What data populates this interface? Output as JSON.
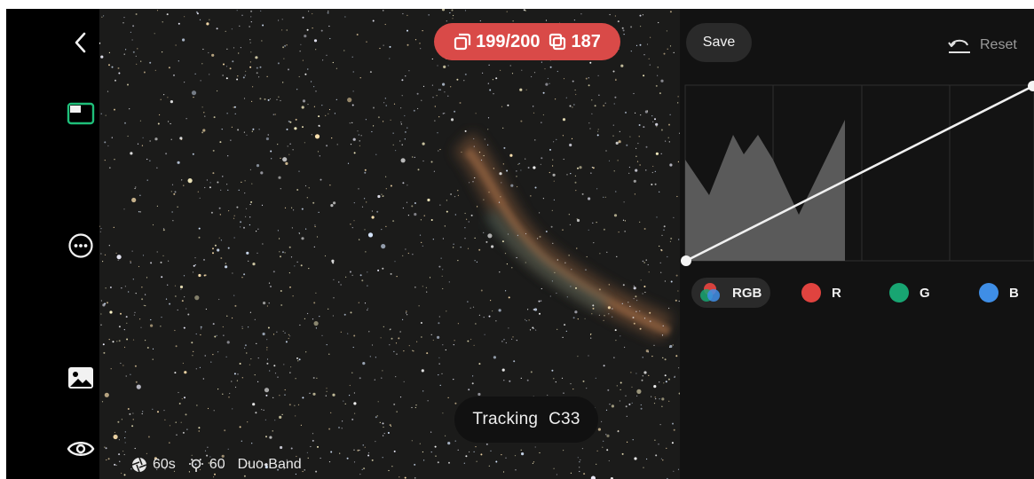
{
  "rail": {
    "icons": [
      "back-icon",
      "layout-icon",
      "more-icon",
      "gallery-icon",
      "eye-icon"
    ],
    "accent": "#1fbf7a"
  },
  "viewer": {
    "frames": "199/200",
    "stacked": "187",
    "pill_color": "#d94a48",
    "tracking_label": "Tracking",
    "target": "C33",
    "exposure": "60s",
    "gain": "60",
    "filter": "Duo-Band"
  },
  "panel": {
    "save_label": "Save",
    "reset_label": "Reset",
    "channels": [
      {
        "label": "RGB",
        "color": "multi",
        "active": true
      },
      {
        "label": "R",
        "color": "#e0433f",
        "active": false
      },
      {
        "label": "G",
        "color": "#18a572",
        "active": false
      },
      {
        "label": "B",
        "color": "#3f8ee6",
        "active": false
      }
    ]
  }
}
